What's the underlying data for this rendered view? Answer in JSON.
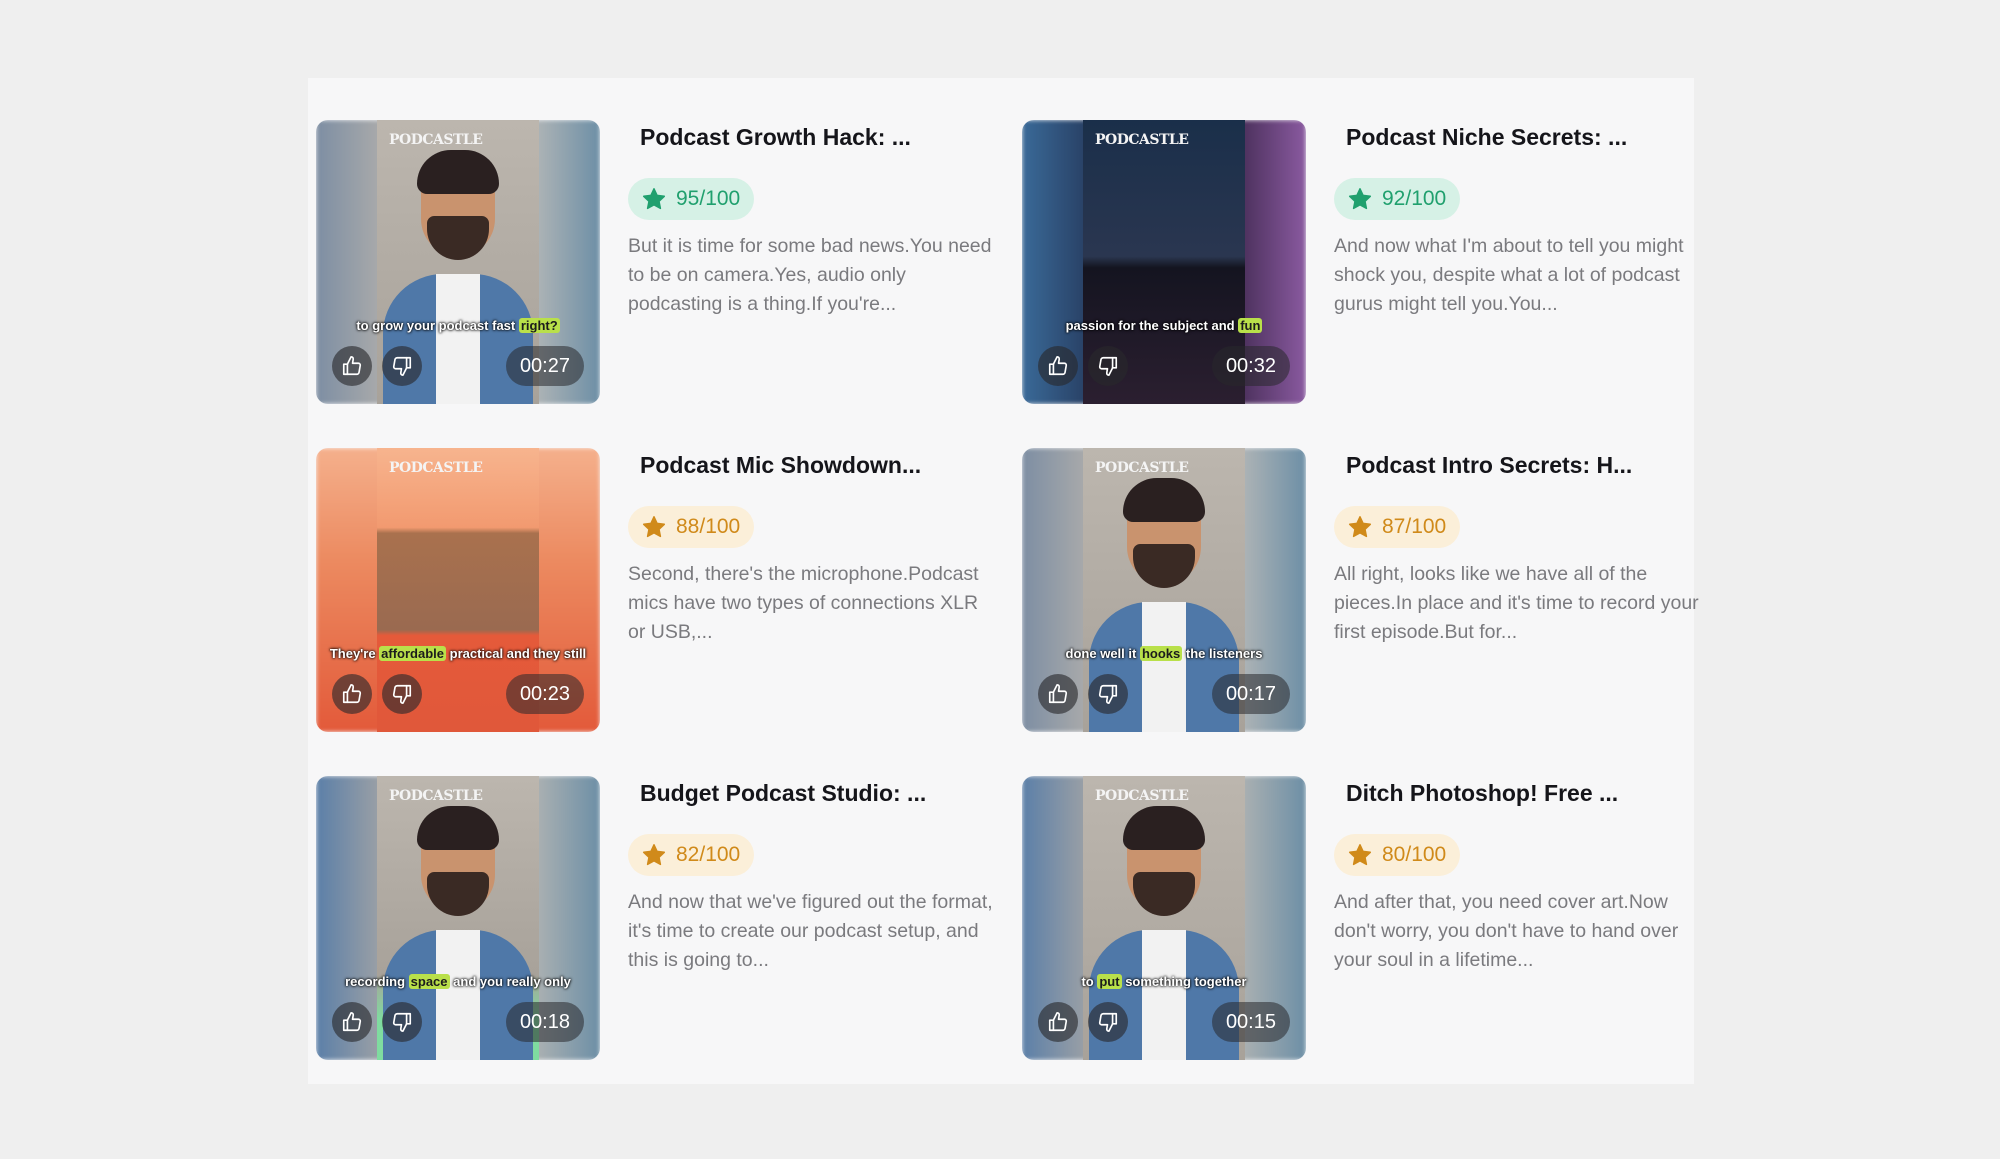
{
  "logo_text": "PODCASTLE",
  "colors": {
    "score_high": "#20a06e",
    "score_mid": "#d08a1a",
    "page_bg": "#efefef",
    "panel_bg": "#f7f7f8"
  },
  "icons": {
    "like": "thumbs-up-icon",
    "dislike": "thumbs-down-icon",
    "score": "star-icon"
  },
  "clips": [
    {
      "title": "Podcast Growth Hack: ...",
      "score": "95/100",
      "score_level": "high",
      "description": "But it is time for some bad news.You need to be on camera.Yes, audio only podcasting is a thing.If you're...",
      "duration": "00:27",
      "caption_pre": "to grow your podcast fast ",
      "caption_hl": "right?",
      "caption_post": ""
    },
    {
      "title": "Podcast Niche Secrets: ...",
      "score": "92/100",
      "score_level": "high",
      "description": "And now what I'm about to tell you might shock you, despite what a lot of podcast gurus might tell you.You...",
      "duration": "00:32",
      "caption_pre": "passion for the subject and ",
      "caption_hl": "fun",
      "caption_post": ""
    },
    {
      "title": "Podcast Mic Showdown...",
      "score": "88/100",
      "score_level": "mid",
      "description": "Second, there's the microphone.Podcast mics have two types of connections XLR or USB,...",
      "duration": "00:23",
      "caption_pre": "They're ",
      "caption_hl": "affordable",
      "caption_post": " practical and they still"
    },
    {
      "title": "Podcast Intro Secrets: H...",
      "score": "87/100",
      "score_level": "mid",
      "description": "All right, looks like we have all of the pieces.In place and it's time to record your first episode.But for...",
      "duration": "00:17",
      "caption_pre": "done well it ",
      "caption_hl": "hooks",
      "caption_post": " the listeners"
    },
    {
      "title": "Budget Podcast Studio: ...",
      "score": "82/100",
      "score_level": "mid",
      "description": "And now that we've figured out the format, it's time to create our podcast setup, and this is going to...",
      "duration": "00:18",
      "caption_pre": "recording ",
      "caption_hl": "space",
      "caption_post": " and you really only"
    },
    {
      "title": "Ditch Photoshop! Free ...",
      "score": "80/100",
      "score_level": "mid",
      "description": "And after that, you need cover art.Now don't worry, you don't have to hand over your soul in a lifetime...",
      "duration": "00:15",
      "caption_pre": "to ",
      "caption_hl": "put",
      "caption_post": " something together"
    }
  ]
}
